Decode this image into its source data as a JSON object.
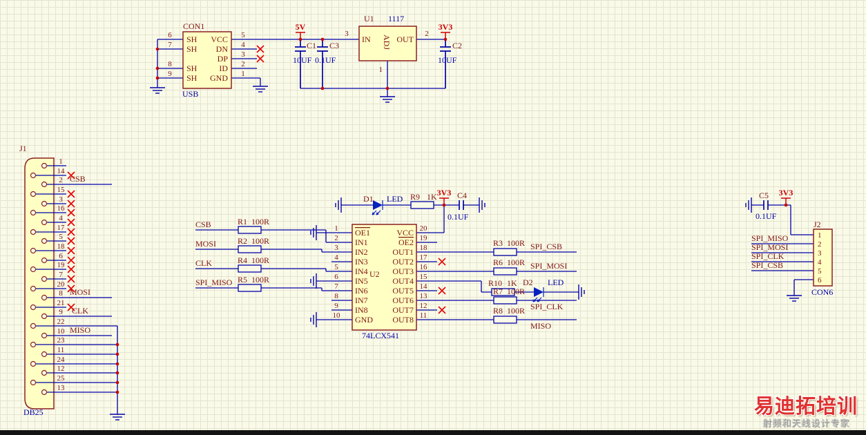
{
  "watermark": {
    "title": "易迪拓培训",
    "subtitle": "射频和天线设计专家"
  },
  "power": {
    "v5": "5V",
    "v33": "3V3"
  },
  "nets": {
    "csb": "CSB",
    "mosi": "MOSI",
    "clk": "CLK",
    "miso": "MISO",
    "spi_csb": "SPI_CSB",
    "spi_mosi": "SPI_MOSI",
    "spi_clk": "SPI_CLK",
    "spi_miso": "SPI_MISO"
  },
  "usb": {
    "designator": "CON1",
    "comment": "USB",
    "left_names": [
      "SH",
      "SH",
      "SH",
      "SH"
    ],
    "left_nums": [
      "6",
      "7",
      "8",
      "9"
    ],
    "right_names": [
      "VCC",
      "DN",
      "DP",
      "ID",
      "GND"
    ],
    "right_nums": [
      "5",
      "4",
      "3",
      "2",
      "1"
    ]
  },
  "u1": {
    "designator": "U1",
    "comment": "1117",
    "in": "IN",
    "out": "OUT",
    "adj": "ADJ",
    "num_in": "3",
    "num_out": "2",
    "num_adj": "1"
  },
  "caps": {
    "c1": {
      "ref": "C1",
      "val": "10UF"
    },
    "c2": {
      "ref": "C2",
      "val": "10UF"
    },
    "c3": {
      "ref": "C3",
      "val": "0.1UF"
    },
    "c4": {
      "ref": "C4",
      "val": "0.1UF"
    },
    "c5": {
      "ref": "C5",
      "val": "0.1UF"
    }
  },
  "res": {
    "r1": {
      "ref": "R1",
      "val": "100R"
    },
    "r2": {
      "ref": "R2",
      "val": "100R"
    },
    "r3": {
      "ref": "R3",
      "val": "100R"
    },
    "r4": {
      "ref": "R4",
      "val": "100R"
    },
    "r5": {
      "ref": "R5",
      "val": "100R"
    },
    "r6": {
      "ref": "R6",
      "val": "100R"
    },
    "r7": {
      "ref": "R7",
      "val": "100R"
    },
    "r8": {
      "ref": "R8",
      "val": "100R"
    },
    "r9": {
      "ref": "R9",
      "val": "1K"
    },
    "r10": {
      "ref": "R10",
      "val": "1K"
    }
  },
  "diodes": {
    "d1": {
      "ref": "D1",
      "val": "LED"
    },
    "d2": {
      "ref": "D2",
      "val": "LED"
    }
  },
  "u2": {
    "designator": "U2",
    "comment": "74LCX541",
    "left_nums": [
      "1",
      "2",
      "3",
      "4",
      "5",
      "6",
      "7",
      "8",
      "9",
      "10"
    ],
    "left_names": [
      "OE1",
      "IN1",
      "IN2",
      "IN3",
      "IN4",
      "IN5",
      "IN6",
      "IN7",
      "IN8",
      "GND"
    ],
    "right_nums": [
      "20",
      "19",
      "18",
      "17",
      "16",
      "15",
      "14",
      "13",
      "12",
      "11"
    ],
    "right_names": [
      "VCC",
      "OE2",
      "OUT1",
      "OUT2",
      "OUT3",
      "OUT4",
      "OUT5",
      "OUT6",
      "OUT7",
      "OUT8"
    ]
  },
  "j1": {
    "designator": "J1",
    "comment": "DB25",
    "nums": [
      "1",
      "14",
      "2",
      "15",
      "3",
      "16",
      "4",
      "17",
      "5",
      "18",
      "6",
      "19",
      "7",
      "20",
      "8",
      "21",
      "9",
      "22",
      "10",
      "23",
      "11",
      "24",
      "12",
      "25",
      "13"
    ]
  },
  "j2": {
    "designator": "J2",
    "comment": "CON6",
    "nums": [
      "1",
      "2",
      "3",
      "4",
      "5",
      "6"
    ]
  }
}
